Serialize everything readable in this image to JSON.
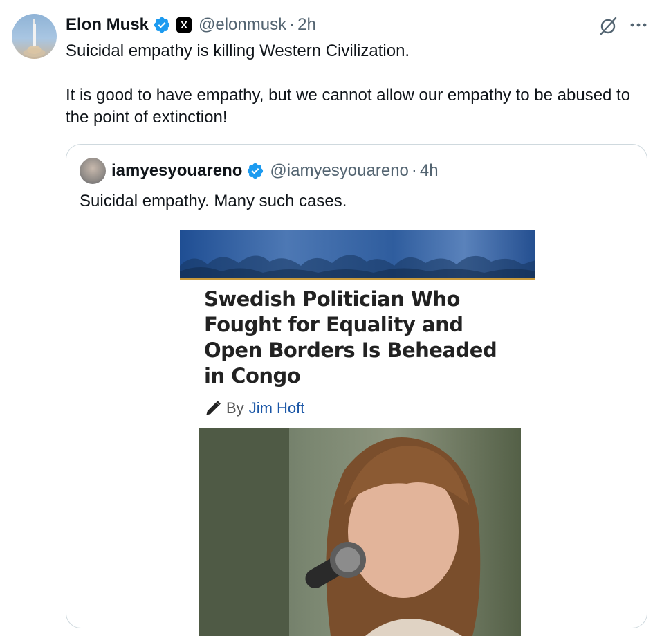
{
  "tweet": {
    "author_name": "Elon Musk",
    "affiliate_badge": "X",
    "handle": "@elonmusk",
    "separator": "·",
    "time": "2h",
    "text_p1": "Suicidal empathy is killing Western Civilization.",
    "text_p2": "It is good to have empathy, but we cannot allow our empathy to be abused to the point of extinction!",
    "icons": {
      "verified": "verified-badge-icon",
      "grok": "grok-icon",
      "more": "more-icon"
    }
  },
  "quote": {
    "author_name": "iamyesyouareno",
    "handle": "@iamyesyouareno",
    "separator": "·",
    "time": "4h",
    "text": "Suicidal empathy. Many such cases.",
    "article": {
      "headline": "Swedish Politician Who Fought for Equality and Open Borders Is Beheaded in Congo",
      "by_label": "By",
      "author": "Jim Hoft"
    }
  },
  "colors": {
    "verified": "#1d9bf0",
    "secondary_text": "#536471",
    "border": "#cfd9de",
    "author_link": "#1a56a6"
  }
}
